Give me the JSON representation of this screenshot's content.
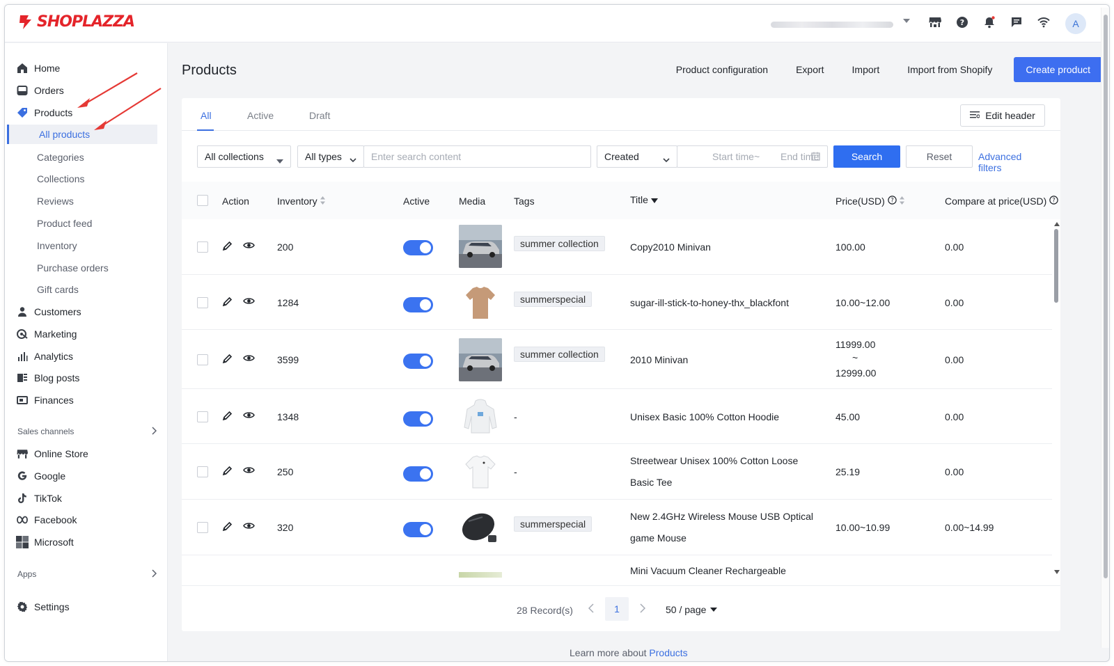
{
  "brand": {
    "name": "SHOPLAZZA",
    "color": "#e4242a"
  },
  "topbar": {
    "avatar_initial": "A",
    "icons": [
      "store-icon",
      "help-icon",
      "bell-icon",
      "chat-icon",
      "wifi-icon"
    ]
  },
  "sidebar": {
    "main_items": [
      {
        "label": "Home",
        "icon": "home-icon"
      },
      {
        "label": "Orders",
        "icon": "orders-icon"
      },
      {
        "label": "Products",
        "icon": "tag-icon"
      }
    ],
    "product_sub": [
      {
        "label": "All products",
        "active": true
      },
      {
        "label": "Categories"
      },
      {
        "label": "Collections"
      },
      {
        "label": "Reviews"
      },
      {
        "label": "Product feed"
      },
      {
        "label": "Inventory"
      },
      {
        "label": "Purchase orders"
      },
      {
        "label": "Gift cards"
      }
    ],
    "more_items": [
      {
        "label": "Customers",
        "icon": "person-icon"
      },
      {
        "label": "Marketing",
        "icon": "marketing-icon"
      },
      {
        "label": "Analytics",
        "icon": "analytics-icon"
      },
      {
        "label": "Blog posts",
        "icon": "blog-icon"
      },
      {
        "label": "Finances",
        "icon": "finances-icon"
      }
    ],
    "sales_channels_label": "Sales channels",
    "channels": [
      {
        "label": "Online Store",
        "icon": "store-icon"
      },
      {
        "label": "Google",
        "icon": "google-icon"
      },
      {
        "label": "TikTok",
        "icon": "tiktok-icon"
      },
      {
        "label": "Facebook",
        "icon": "meta-icon"
      },
      {
        "label": "Microsoft",
        "icon": "microsoft-icon"
      }
    ],
    "apps_label": "Apps",
    "settings_label": "Settings"
  },
  "page": {
    "title": "Products",
    "actions": [
      "Product configuration",
      "Export",
      "Import",
      "Import from Shopify"
    ],
    "create_label": "Create product"
  },
  "tabs": [
    {
      "label": "All",
      "active": true
    },
    {
      "label": "Active"
    },
    {
      "label": "Draft"
    }
  ],
  "edit_header_label": "Edit header",
  "filters": {
    "collections": "All collections",
    "types": "All types",
    "search_placeholder": "Enter search content",
    "sort": "Created",
    "start_placeholder": "Start time",
    "tilde": "~",
    "end_placeholder": "End time",
    "search_label": "Search",
    "reset_label": "Reset",
    "advanced_label": "Advanced filters"
  },
  "table": {
    "headers": {
      "action": "Action",
      "inventory": "Inventory",
      "active": "Active",
      "media": "Media",
      "tags": "Tags",
      "title": "Title",
      "price": "Price(USD)",
      "compare": "Compare at price(USD)"
    },
    "rows": [
      {
        "inventory": "200",
        "tag": "summer collection",
        "title": "Copy2010 Minivan",
        "price": "100.00",
        "compare": "0.00",
        "media": "minivan"
      },
      {
        "inventory": "1284",
        "tag": "summerspecial",
        "title": "sugar-ill-stick-to-honey-thx_blackfont",
        "price": "10.00~12.00",
        "compare": "0.00",
        "media": "tshirt-brown"
      },
      {
        "inventory": "3599",
        "tag": "summer collection",
        "title": "2010 Minivan",
        "price_top": "11999.00",
        "price_mid": "~",
        "price_bottom": "12999.00",
        "compare": "0.00",
        "media": "minivan"
      },
      {
        "inventory": "1348",
        "tag": "-",
        "title": "Unisex Basic 100% Cotton Hoodie",
        "price": "45.00",
        "compare": "0.00",
        "media": "hoodie"
      },
      {
        "inventory": "250",
        "tag": "-",
        "title": "Streetwear Unisex 100% Cotton Loose Basic Tee",
        "price": "25.19",
        "compare": "0.00",
        "media": "tee-white"
      },
      {
        "inventory": "320",
        "tag": "summerspecial",
        "title": "New 2.4GHz Wireless Mouse USB Optical game Mouse",
        "price": "10.00~10.99",
        "compare": "0.00~14.99",
        "media": "mouse"
      },
      {
        "title": "Mini Vacuum Cleaner Rechargeable",
        "media": "vacuum"
      }
    ]
  },
  "pagination": {
    "records": "28 Record(s)",
    "current": "1",
    "per_page": "50 / page"
  },
  "footer": {
    "learn_prefix": "Learn more about ",
    "learn_link": "Products"
  },
  "colors": {
    "accent": "#3d6ef0",
    "annotation_arrow": "#e53935"
  }
}
